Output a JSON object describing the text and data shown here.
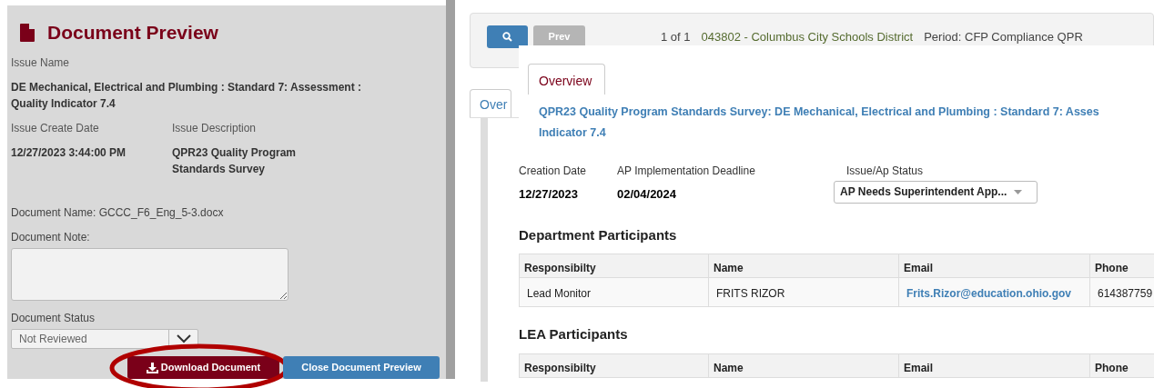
{
  "preview": {
    "title": "Document Preview",
    "issue_name": {
      "label": "Issue Name",
      "value": "DE Mechanical, Electrical and Plumbing : Standard 7: Assessment : Quality Indicator 7.4"
    },
    "issue_create_date": {
      "label": "Issue Create Date",
      "value": "12/27/2023 3:44:00 PM"
    },
    "issue_description": {
      "label": "Issue Description",
      "value": "QPR23 Quality Program Standards Survey"
    },
    "document_name": "Document Name: GCCC_F6_Eng_5-3.docx",
    "document_note": {
      "label": "Document Note:"
    },
    "document_status": {
      "label": "Document Status",
      "value": "Not Reviewed"
    },
    "buttons": [
      {
        "label": "Download Document",
        "kind": "download",
        "highlighted": true
      },
      {
        "label": "Close Document Preview",
        "kind": "close",
        "highlighted": false
      }
    ]
  },
  "toolbar": {
    "prev": "Prev",
    "count": "1 of 1",
    "district": "043802 - Columbus City Schools District",
    "period": "Period: CFP Compliance QPR"
  },
  "background_tab": "Over",
  "overview": {
    "tab": "Overview",
    "title_lines": [
      "QPR23 Quality Program Standards Survey: DE Mechanical, Electrical and Plumbing : Standard 7: Asses",
      "Indicator 7.4"
    ],
    "fields": [
      {
        "label": "Creation Date",
        "value": "12/27/2023"
      },
      {
        "label": "AP Implementation Deadline",
        "value": "02/04/2024"
      }
    ],
    "status": {
      "label": "Issue/Ap Status",
      "value": "AP Needs Superintendent App..."
    },
    "tables": [
      {
        "title": "Department Participants",
        "columns": [
          "Responsibilty",
          "Name",
          "Email",
          "Phone"
        ],
        "rows": [
          [
            "Lead Monitor",
            "FRITS RIZOR",
            "Frits.Rizor@education.ohio.gov",
            "614387759"
          ]
        ]
      },
      {
        "title": "LEA Participants",
        "columns": [
          "Responsibilty",
          "Name",
          "Email",
          "Phone"
        ]
      }
    ]
  }
}
